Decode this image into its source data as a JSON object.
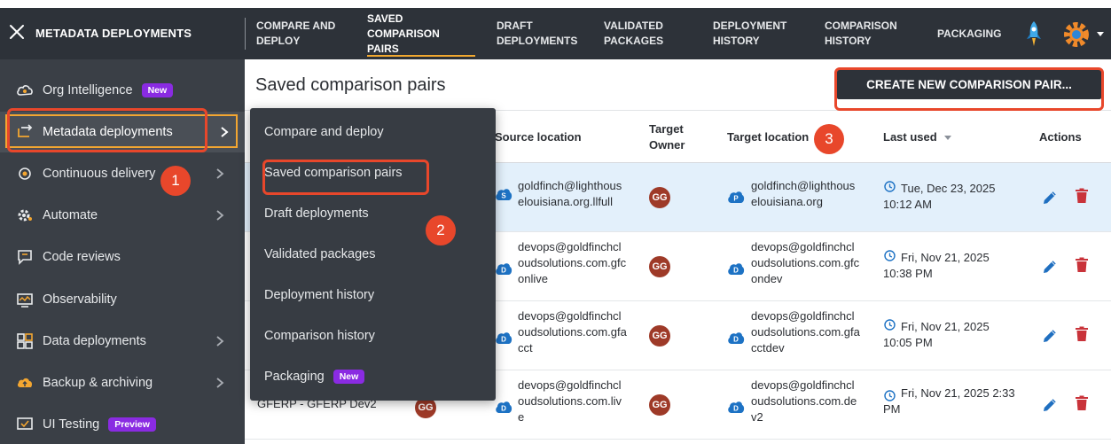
{
  "app": {
    "title": "METADATA DEPLOYMENTS"
  },
  "topnav": [
    {
      "label": "COMPARE AND DEPLOY"
    },
    {
      "label": "SAVED COMPARISON PAIRS",
      "active": true
    },
    {
      "label": "DRAFT DEPLOYMENTS"
    },
    {
      "label": "VALIDATED PACKAGES"
    },
    {
      "label": "DEPLOYMENT HISTORY"
    },
    {
      "label": "COMPARISON HISTORY"
    },
    {
      "label": "PACKAGING"
    }
  ],
  "sidebar": {
    "items": [
      {
        "label": "Org Intelligence",
        "badge": "New",
        "icon": "cloud-icon"
      },
      {
        "label": "Metadata deployments",
        "icon": "deploy-icon",
        "active": true
      },
      {
        "label": "Continuous delivery",
        "icon": "pipeline-icon"
      },
      {
        "label": "Automate",
        "icon": "gear-icon"
      },
      {
        "label": "Code reviews",
        "icon": "chat-icon"
      },
      {
        "label": "Observability",
        "icon": "monitor-icon"
      },
      {
        "label": "Data deployments",
        "icon": "grid-icon"
      },
      {
        "label": "Backup & archiving",
        "icon": "cloud-upload-icon"
      },
      {
        "label": "UI Testing",
        "badge": "Preview",
        "icon": "ui-test-icon"
      }
    ]
  },
  "dropdown": {
    "items": [
      {
        "label": "Compare and deploy"
      },
      {
        "label": "Saved comparison pairs"
      },
      {
        "label": "Draft deployments"
      },
      {
        "label": "Validated packages"
      },
      {
        "label": "Deployment history"
      },
      {
        "label": "Comparison history"
      },
      {
        "label": "Packaging",
        "badge": "New"
      }
    ]
  },
  "main": {
    "title": "Saved comparison pairs",
    "create_button": "CREATE NEW COMPARISON PAIR...",
    "columns": {
      "source_location": "Source location",
      "target_owner": "Target Owner",
      "target_location": "Target location",
      "last_used": "Last used",
      "actions": "Actions"
    },
    "rows": [
      {
        "name": "",
        "source_owner": "",
        "source_type": "S",
        "source": "goldfinch@lighthouselouisiana.org.llfull",
        "source_lines": [
          "goldfinch@lighthous",
          "elouisiana.org.llfull"
        ],
        "target_owner": "GG",
        "target_type": "P",
        "target_lines": [
          "goldfinch@lighthous",
          "elouisiana.org"
        ],
        "last_used_lines": [
          "Tue, Dec 23, 2025",
          "10:12 AM"
        ]
      },
      {
        "name": "",
        "source_owner": "",
        "source_type": "D",
        "source_lines": [
          "devops@goldfinchcl",
          "oudsolutions.com.gfc",
          "onlive"
        ],
        "target_owner": "GG",
        "target_type": "D",
        "target_lines": [
          "devops@goldfinchcl",
          "oudsolutions.com.gfc",
          "ondev"
        ],
        "last_used_lines": [
          "Fri, Nov 21, 2025",
          "10:38 PM"
        ]
      },
      {
        "name": "",
        "source_owner": "",
        "source_type": "D",
        "source_lines": [
          "devops@goldfinchcl",
          "oudsolutions.com.gfa",
          "cct"
        ],
        "target_owner": "GG",
        "target_type": "D",
        "target_lines": [
          "devops@goldfinchcl",
          "oudsolutions.com.gfa",
          "cctdev"
        ],
        "last_used_lines": [
          "Fri, Nov 21, 2025",
          "10:05 PM"
        ]
      },
      {
        "name": "GFERP - GFERP Dev2",
        "source_owner": "GG",
        "source_type": "D",
        "source_lines": [
          "devops@goldfinchcl",
          "oudsolutions.com.liv",
          "e"
        ],
        "target_owner": "GG",
        "target_type": "D",
        "target_lines": [
          "devops@goldfinchcl",
          "oudsolutions.com.de",
          "v2"
        ],
        "last_used_lines": [
          "Fri, Nov 21, 2025 2:33",
          "PM"
        ]
      }
    ]
  },
  "annotations": [
    "1",
    "2",
    "3"
  ],
  "colors": {
    "topbar": "#2d3239",
    "sidebar": "#3a3f46",
    "accent_underline": "#f0a830",
    "highlight": "#e8472b",
    "badge": "#8a2be2",
    "edit_icon": "#1f6fc0",
    "delete_icon": "#c9333a",
    "source_icon": "#1d72c4"
  }
}
